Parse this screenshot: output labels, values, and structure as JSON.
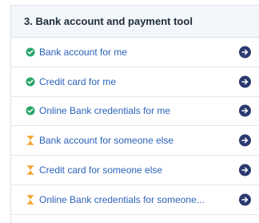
{
  "section": {
    "title": "3. Bank account and payment tool"
  },
  "items": [
    {
      "label": "Bank account for me",
      "status": "done",
      "status_icon": "check-circle-icon"
    },
    {
      "label": "Credit card for me",
      "status": "done",
      "status_icon": "check-circle-icon"
    },
    {
      "label": "Online Bank credentials for me",
      "status": "done",
      "status_icon": "check-circle-icon"
    },
    {
      "label": "Bank account for someone else",
      "status": "pending",
      "status_icon": "hourglass-icon"
    },
    {
      "label": "Credit card for someone else",
      "status": "pending",
      "status_icon": "hourglass-icon"
    },
    {
      "label": "Online Bank credentials for someone...",
      "status": "pending",
      "status_icon": "hourglass-icon"
    }
  ],
  "truncation_marker": ".",
  "colors": {
    "done": "#27a76a",
    "pending": "#f2a229",
    "link": "#2b63b8",
    "arrow": "#2a3a6e"
  }
}
